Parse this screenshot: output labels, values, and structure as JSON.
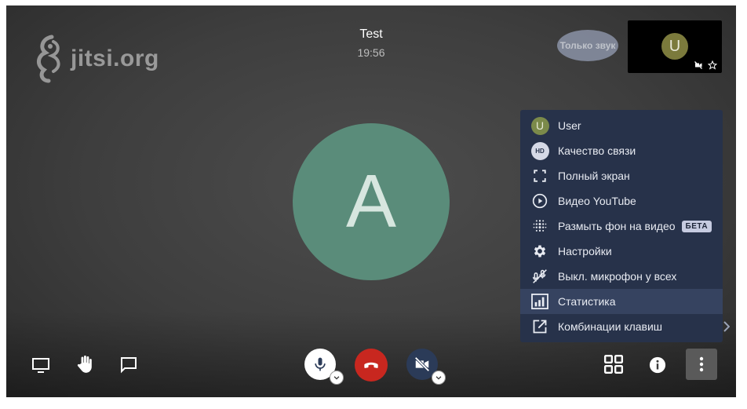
{
  "logo": {
    "text": "jitsi.org",
    "icon": "jitsi-logo-icon"
  },
  "conference": {
    "title": "Test",
    "time": "19:56"
  },
  "audio_only_badge": "Только звук",
  "thumbnail": {
    "avatar_letter": "U",
    "icons": [
      "video-off-icon",
      "star-icon"
    ]
  },
  "main_avatar": {
    "letter": "A",
    "color": "#5a8c7a"
  },
  "menu": {
    "items": [
      {
        "label": "User",
        "icon": "user-avatar",
        "avatar_letter": "U"
      },
      {
        "label": "Качество связи",
        "icon": "hd-icon",
        "icon_text": "HD"
      },
      {
        "label": "Полный экран",
        "icon": "fullscreen-icon"
      },
      {
        "label": "Видео YouTube",
        "icon": "play-icon"
      },
      {
        "label": "Размыть фон на видео",
        "icon": "blur-icon",
        "badge": "БЕТА"
      },
      {
        "label": "Настройки",
        "icon": "gear-icon"
      },
      {
        "label": "Выкл. микрофон у всех",
        "icon": "mute-everyone-icon"
      },
      {
        "label": "Статистика",
        "icon": "stats-icon",
        "active": true
      },
      {
        "label": "Комбинации клавиш",
        "icon": "external-link-icon"
      }
    ]
  },
  "toolbar": {
    "left": [
      "screen-share-icon",
      "raise-hand-icon",
      "chat-icon"
    ],
    "center": [
      "microphone-icon",
      "hangup-icon",
      "camera-off-icon"
    ],
    "right": [
      "tile-view-icon",
      "info-icon",
      "more-icon"
    ]
  },
  "colors": {
    "menu_bg": "#27324a",
    "hangup": "#c8271f",
    "avatar_main": "#5a8c7a",
    "avatar_user": "#7b8a4a"
  }
}
